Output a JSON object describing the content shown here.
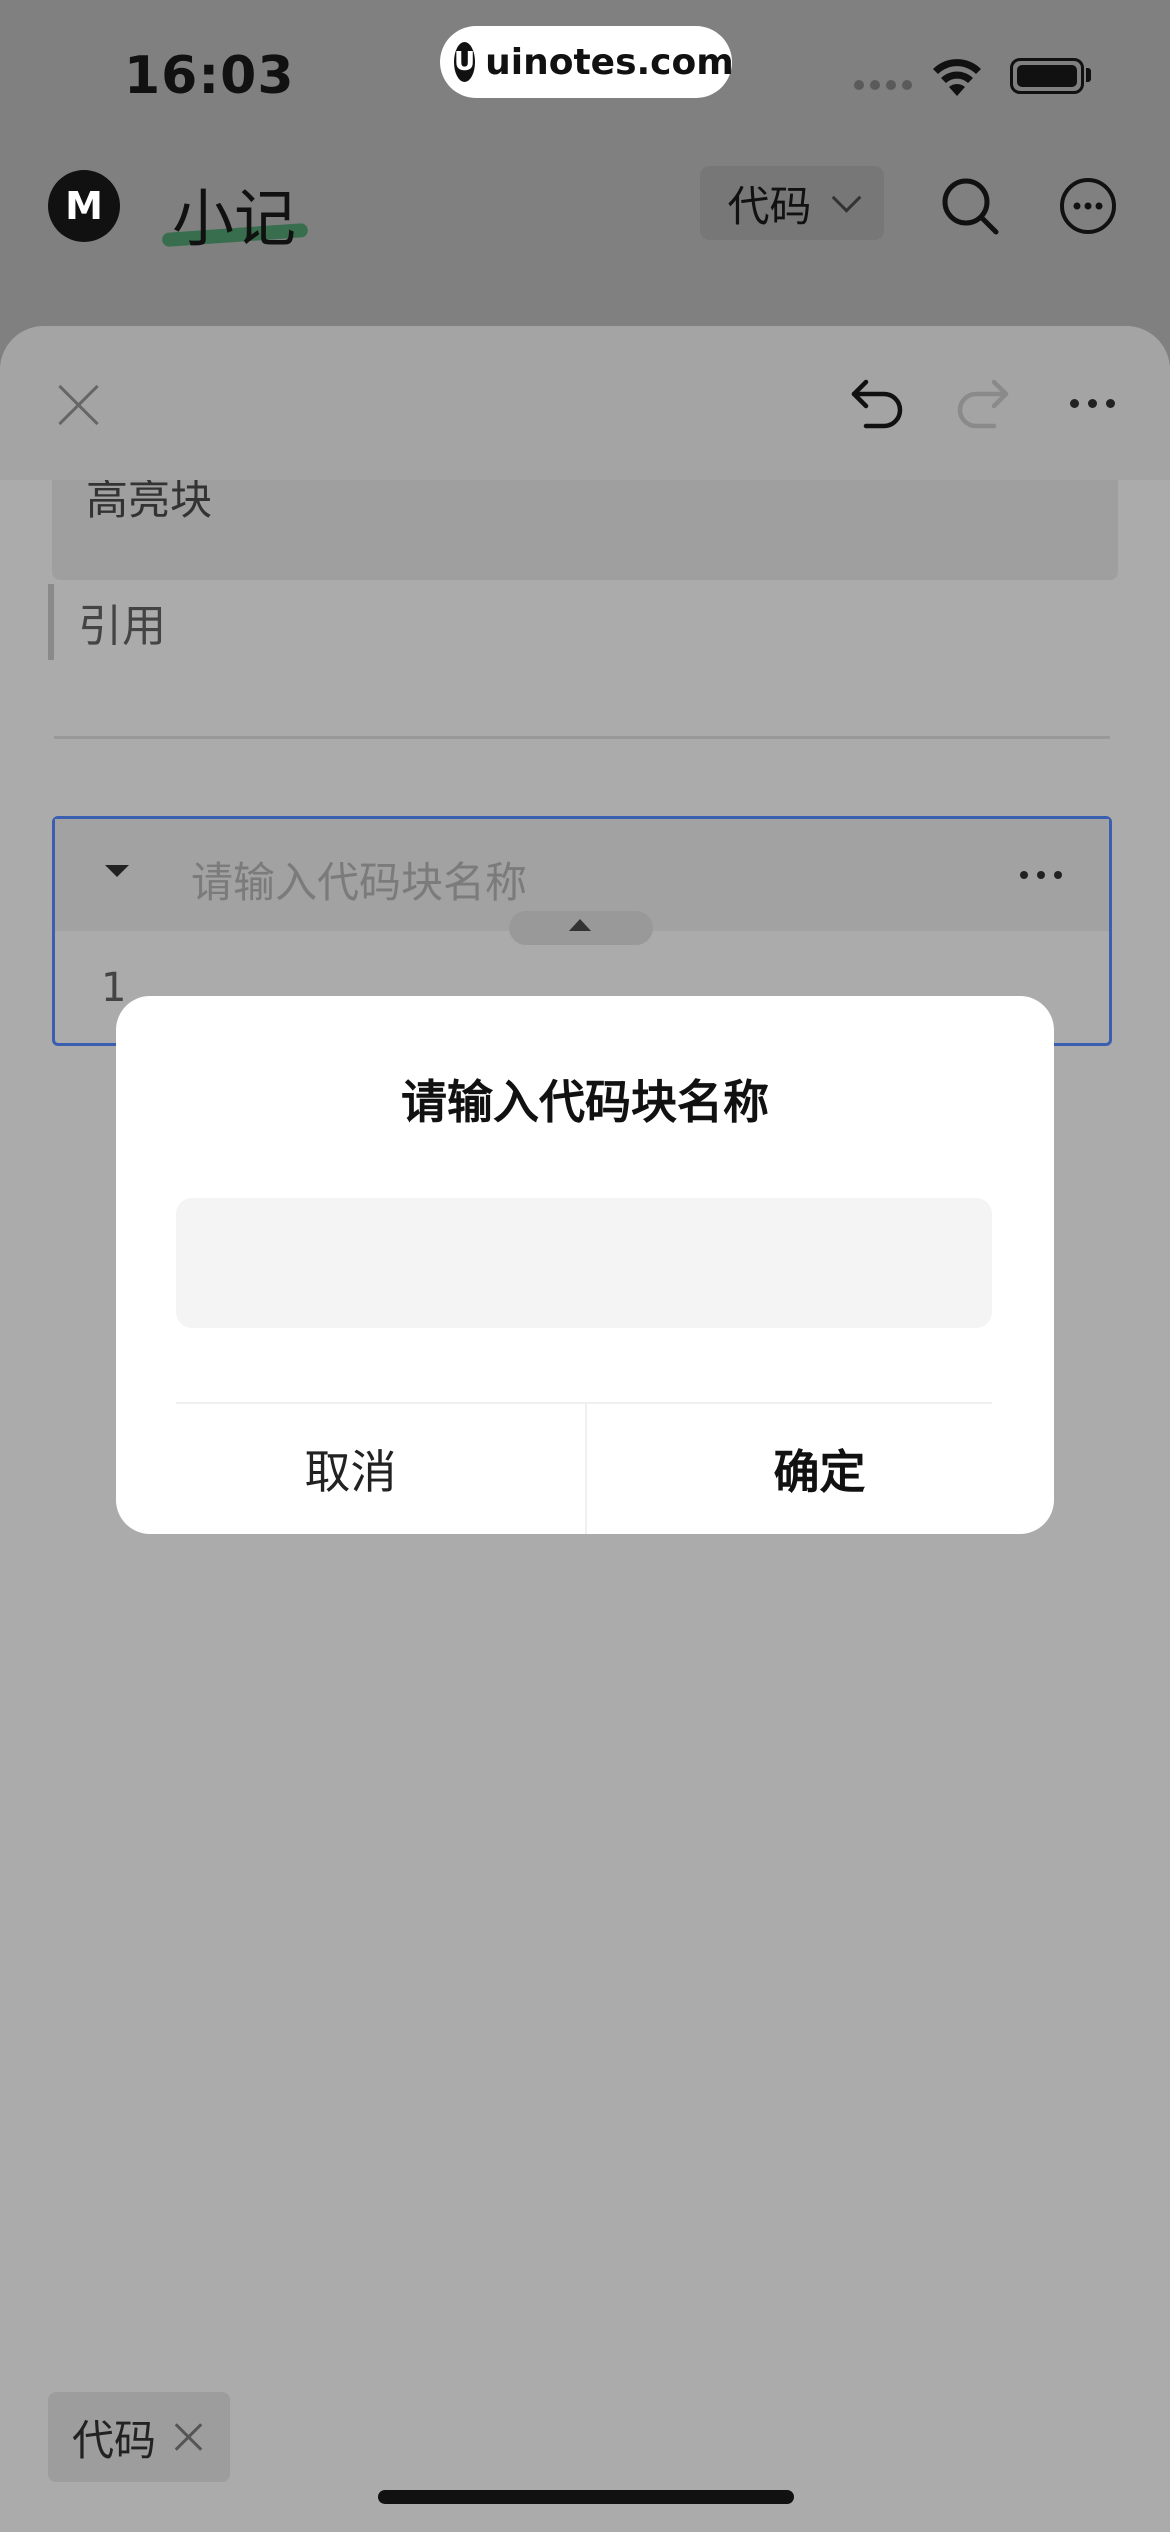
{
  "status_bar": {
    "time": "16:03",
    "url": "uinotes.com",
    "url_logo": "U"
  },
  "header": {
    "logo_letter": "M",
    "title": "小记",
    "code_dropdown": "代码",
    "search_icon": "search-icon",
    "more_icon": "more-circle-icon"
  },
  "editor": {
    "highlight_block_text": "高亮块",
    "quote_text": "引用",
    "code_block": {
      "name_placeholder": "请输入代码块名称",
      "line_number": "1"
    }
  },
  "dialog": {
    "title": "请输入代码块名称",
    "input_value": "",
    "cancel_label": "取消",
    "confirm_label": "确定"
  },
  "tags": [
    {
      "label": "代码"
    }
  ],
  "colors": {
    "code_block_border": "#3a5fb0",
    "title_underline": "#2c6b45"
  }
}
